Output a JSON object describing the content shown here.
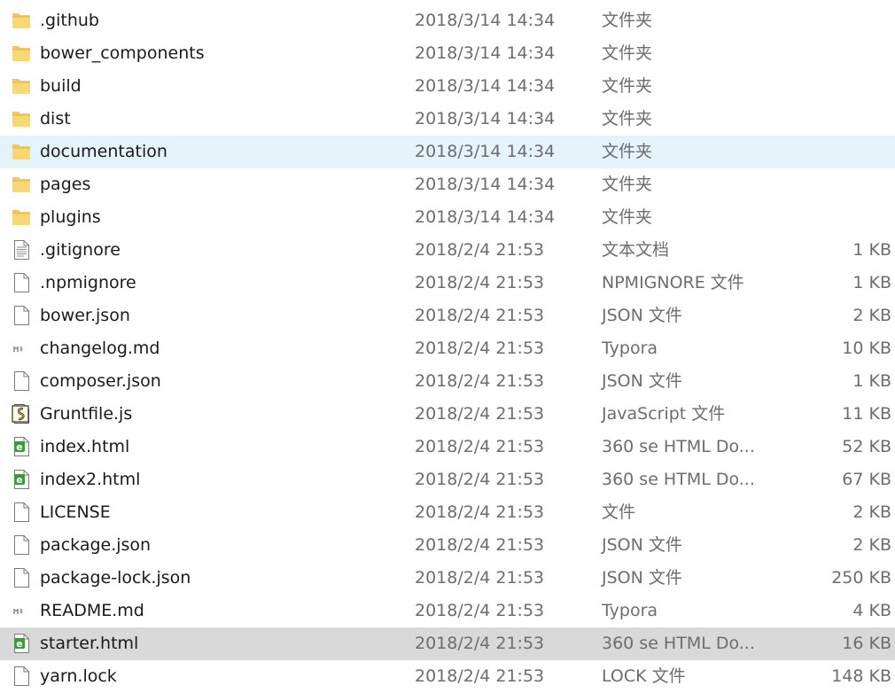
{
  "files": [
    {
      "name": ".github",
      "date": "2018/3/14 14:34",
      "type": "文件夹",
      "size": "",
      "icon": "folder-icon",
      "state": ""
    },
    {
      "name": "bower_components",
      "date": "2018/3/14 14:34",
      "type": "文件夹",
      "size": "",
      "icon": "folder-icon",
      "state": ""
    },
    {
      "name": "build",
      "date": "2018/3/14 14:34",
      "type": "文件夹",
      "size": "",
      "icon": "folder-icon",
      "state": ""
    },
    {
      "name": "dist",
      "date": "2018/3/14 14:34",
      "type": "文件夹",
      "size": "",
      "icon": "folder-icon",
      "state": ""
    },
    {
      "name": "documentation",
      "date": "2018/3/14 14:34",
      "type": "文件夹",
      "size": "",
      "icon": "folder-icon",
      "state": "hover"
    },
    {
      "name": "pages",
      "date": "2018/3/14 14:34",
      "type": "文件夹",
      "size": "",
      "icon": "folder-icon",
      "state": ""
    },
    {
      "name": "plugins",
      "date": "2018/3/14 14:34",
      "type": "文件夹",
      "size": "",
      "icon": "folder-icon",
      "state": ""
    },
    {
      "name": ".gitignore",
      "date": "2018/2/4 21:53",
      "type": "文本文档",
      "size": "1 KB",
      "icon": "text-file-icon",
      "state": ""
    },
    {
      "name": ".npmignore",
      "date": "2018/2/4 21:53",
      "type": "NPMIGNORE 文件",
      "size": "1 KB",
      "icon": "blank-file-icon",
      "state": ""
    },
    {
      "name": "bower.json",
      "date": "2018/2/4 21:53",
      "type": "JSON 文件",
      "size": "2 KB",
      "icon": "blank-file-icon",
      "state": ""
    },
    {
      "name": "changelog.md",
      "date": "2018/2/4 21:53",
      "type": "Typora",
      "size": "10 KB",
      "icon": "markdown-file-icon",
      "state": ""
    },
    {
      "name": "composer.json",
      "date": "2018/2/4 21:53",
      "type": "JSON 文件",
      "size": "1 KB",
      "icon": "blank-file-icon",
      "state": ""
    },
    {
      "name": "Gruntfile.js",
      "date": "2018/2/4 21:53",
      "type": "JavaScript 文件",
      "size": "11 KB",
      "icon": "script-file-icon",
      "state": ""
    },
    {
      "name": "index.html",
      "date": "2018/2/4 21:53",
      "type": "360 se HTML Do...",
      "size": "52 KB",
      "icon": "html-file-icon",
      "state": ""
    },
    {
      "name": "index2.html",
      "date": "2018/2/4 21:53",
      "type": "360 se HTML Do...",
      "size": "67 KB",
      "icon": "html-file-icon",
      "state": ""
    },
    {
      "name": "LICENSE",
      "date": "2018/2/4 21:53",
      "type": "文件",
      "size": "2 KB",
      "icon": "blank-file-icon",
      "state": ""
    },
    {
      "name": "package.json",
      "date": "2018/2/4 21:53",
      "type": "JSON 文件",
      "size": "2 KB",
      "icon": "blank-file-icon",
      "state": ""
    },
    {
      "name": "package-lock.json",
      "date": "2018/2/4 21:53",
      "type": "JSON 文件",
      "size": "250 KB",
      "icon": "blank-file-icon",
      "state": ""
    },
    {
      "name": "README.md",
      "date": "2018/2/4 21:53",
      "type": "Typora",
      "size": "4 KB",
      "icon": "markdown-file-icon",
      "state": ""
    },
    {
      "name": "starter.html",
      "date": "2018/2/4 21:53",
      "type": "360 se HTML Do...",
      "size": "16 KB",
      "icon": "html-file-icon",
      "state": "selected"
    },
    {
      "name": "yarn.lock",
      "date": "2018/2/4 21:53",
      "type": "LOCK 文件",
      "size": "148 KB",
      "icon": "blank-file-icon",
      "state": ""
    }
  ],
  "colors": {
    "hover_row": "#e5f3fb",
    "selected_row": "#d9d9d9",
    "folder": "#f8d775",
    "html_badge": "#3c9a3c"
  }
}
